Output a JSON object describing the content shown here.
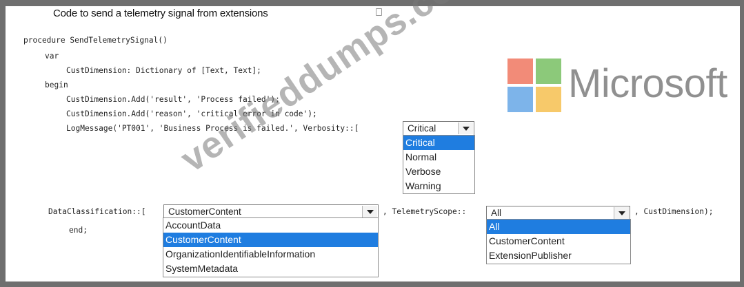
{
  "title": "Code to send a telemetry signal from extensions",
  "code": {
    "line1": "procedure SendTelemetrySignal()",
    "line2": "var",
    "line3": "CustDimension: Dictionary of [Text, Text];",
    "line4": "begin",
    "line5": "CustDimension.Add('result', 'Process failed');",
    "line6": "CustDimension.Add('reason', 'critical error in code');",
    "line7": "LogMessage('PT001', 'Business Process is failed.', Verbosity::[",
    "line8": "DataClassification::[",
    "line9_a": ", TelemetryScope::",
    "line9_b": ", CustDimension);",
    "line10": "end;"
  },
  "verbosity": {
    "selected": "Critical",
    "options": [
      "Critical",
      "Normal",
      "Verbose",
      "Warning"
    ]
  },
  "data_classification": {
    "selected": "CustomerContent",
    "options": [
      "AccountData",
      "CustomerContent",
      "OrganizationIdentifiableInformation",
      "SystemMetadata"
    ]
  },
  "telemetry_scope": {
    "selected": "All",
    "options": [
      "All",
      "CustomerContent",
      "ExtensionPublisher"
    ]
  },
  "logo": {
    "text": "Microsoft",
    "colors": [
      "#f28b78",
      "#8cc97a",
      "#7db4ea",
      "#f7c96a"
    ]
  },
  "watermark": "verifieddumps.com"
}
